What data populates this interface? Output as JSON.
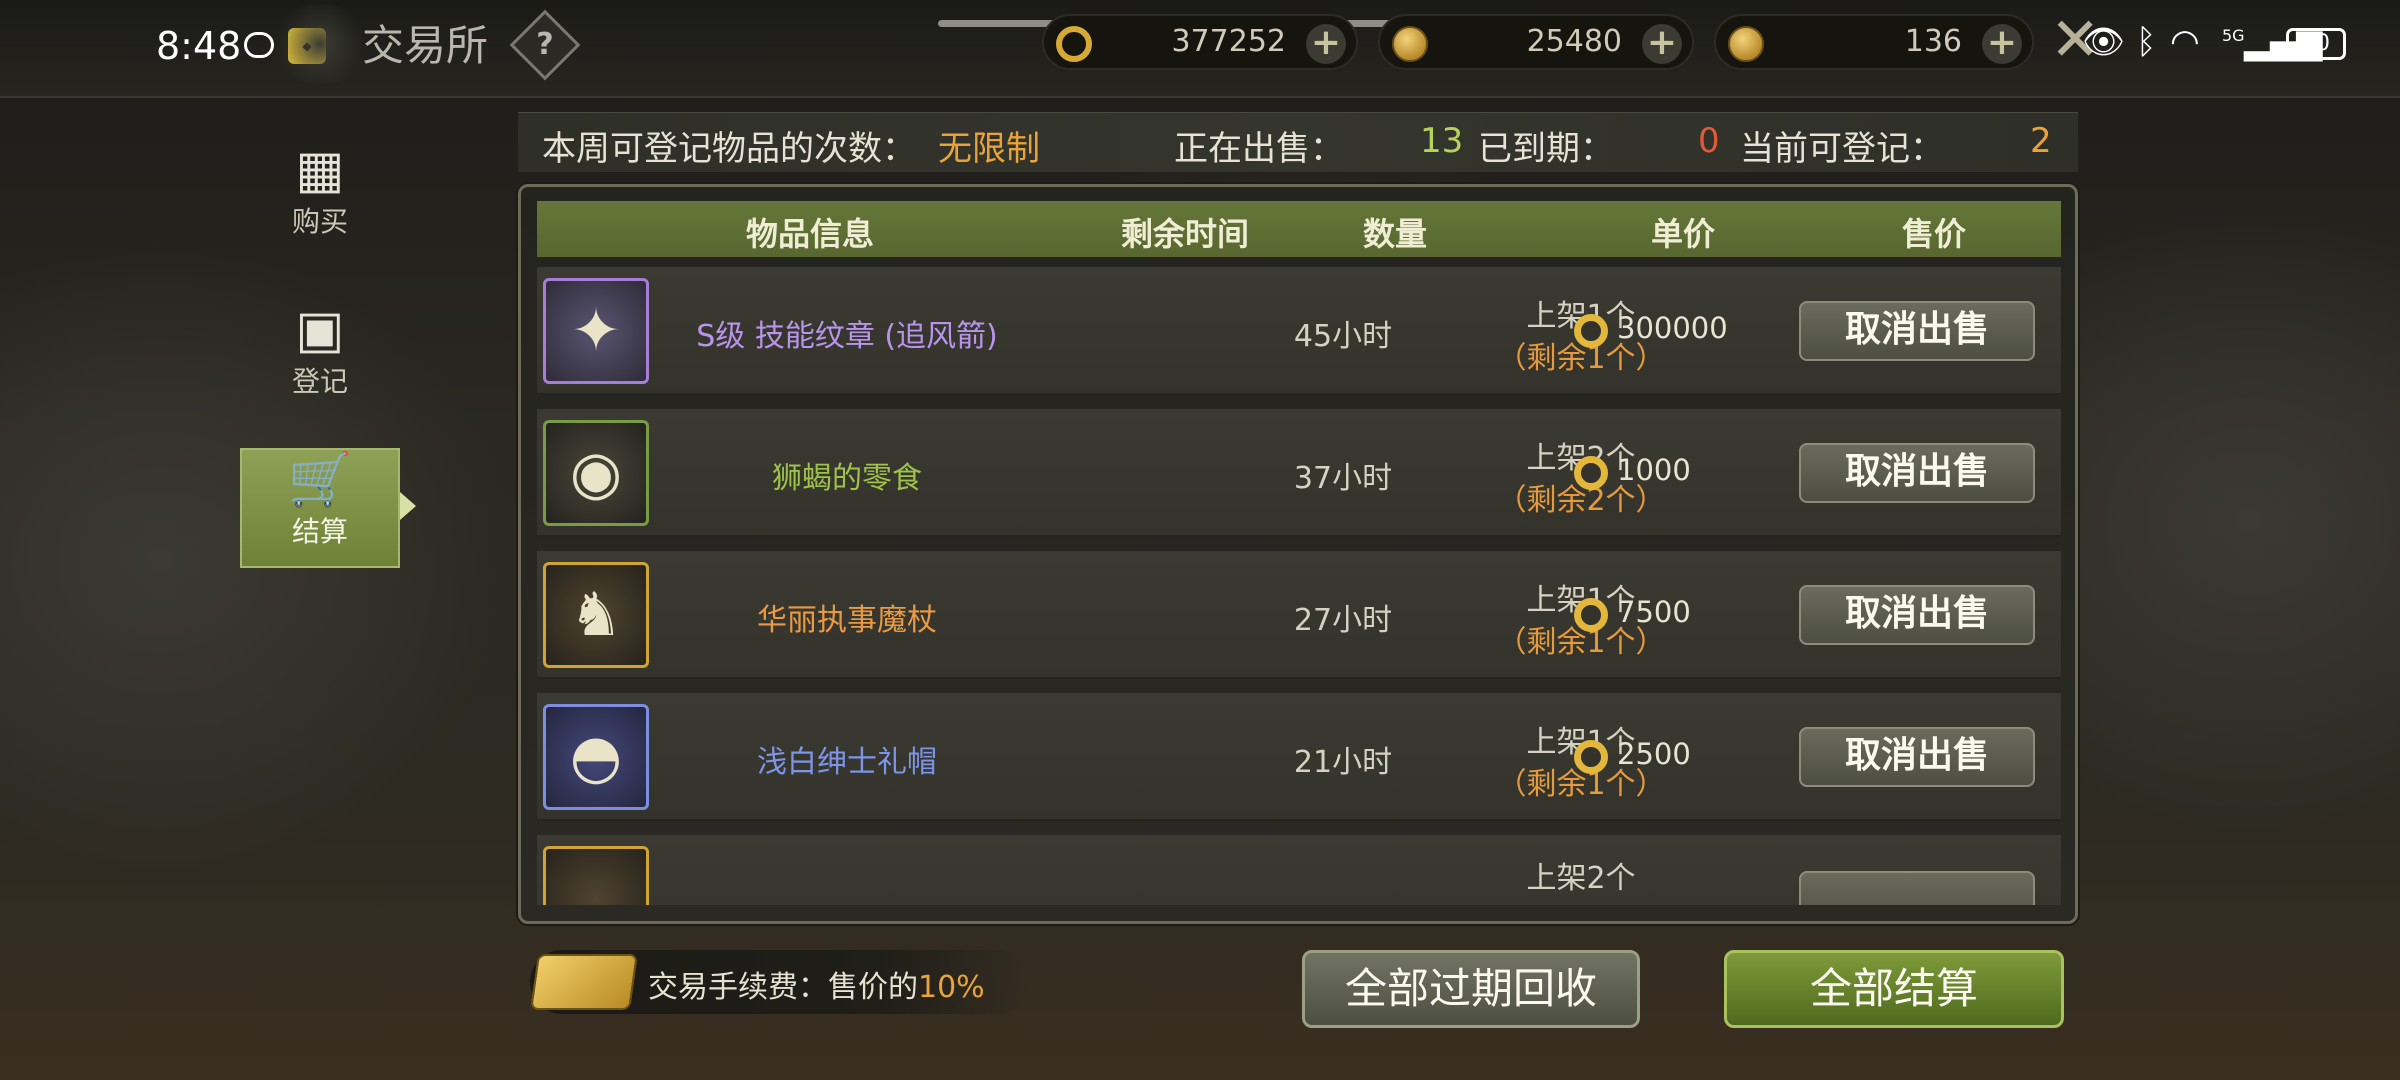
{
  "status_bar": {
    "time": "8:48",
    "network": "5G",
    "battery": "50"
  },
  "header": {
    "title": "交易所",
    "help_label": "?"
  },
  "currencies": [
    {
      "icon": "coin-c-icon",
      "value": "377252"
    },
    {
      "icon": "gold-coin-bag-icon",
      "value": "25480"
    },
    {
      "icon": "bronze-coin-icon",
      "value": "136"
    }
  ],
  "sidebar": {
    "items": [
      {
        "label": "购买",
        "icon": "shop-icon"
      },
      {
        "label": "登记",
        "icon": "register-icon"
      },
      {
        "label": "结算",
        "icon": "cart-icon",
        "active": true
      }
    ]
  },
  "stats": {
    "weekly_label": "本周可登记物品的次数：",
    "weekly_value": "无限制",
    "selling_label": "正在出售：",
    "selling_value": "13",
    "expired_label": "已到期：",
    "expired_value": "0",
    "available_label": "当前可登记：",
    "available_value": "2"
  },
  "table": {
    "headers": [
      "物品信息",
      "剩余时间",
      "数量",
      "单价",
      "售价"
    ],
    "rows": [
      {
        "name": "S级 技能纹章 (追风箭)",
        "name_color": "#b895ea",
        "time": "45小时",
        "listed": "上架1个",
        "remaining": "（剩余1个）",
        "price": "300000",
        "action": "取消出售"
      },
      {
        "name": "狮蝎的零食",
        "name_color": "#9fc24a",
        "time": "37小时",
        "listed": "上架2个",
        "remaining": "（剩余2个）",
        "price": "1000",
        "action": "取消出售"
      },
      {
        "name": "华丽执事魔杖",
        "name_color": "#ea9a44",
        "time": "27小时",
        "listed": "上架1个",
        "remaining": "（剩余1个）",
        "price": "7500",
        "action": "取消出售"
      },
      {
        "name": "浅白绅士礼帽",
        "name_color": "#7d95e6",
        "time": "21小时",
        "listed": "上架1个",
        "remaining": "（剩余1个）",
        "price": "2500",
        "action": "取消出售"
      },
      {
        "name": "",
        "time": "",
        "listed": "上架2个",
        "remaining": "",
        "price": "",
        "action": ""
      }
    ]
  },
  "footer": {
    "fee_label": "交易手续费：售价的",
    "fee_value": "10%",
    "recycle_button": "全部过期回收",
    "settle_button": "全部结算"
  }
}
